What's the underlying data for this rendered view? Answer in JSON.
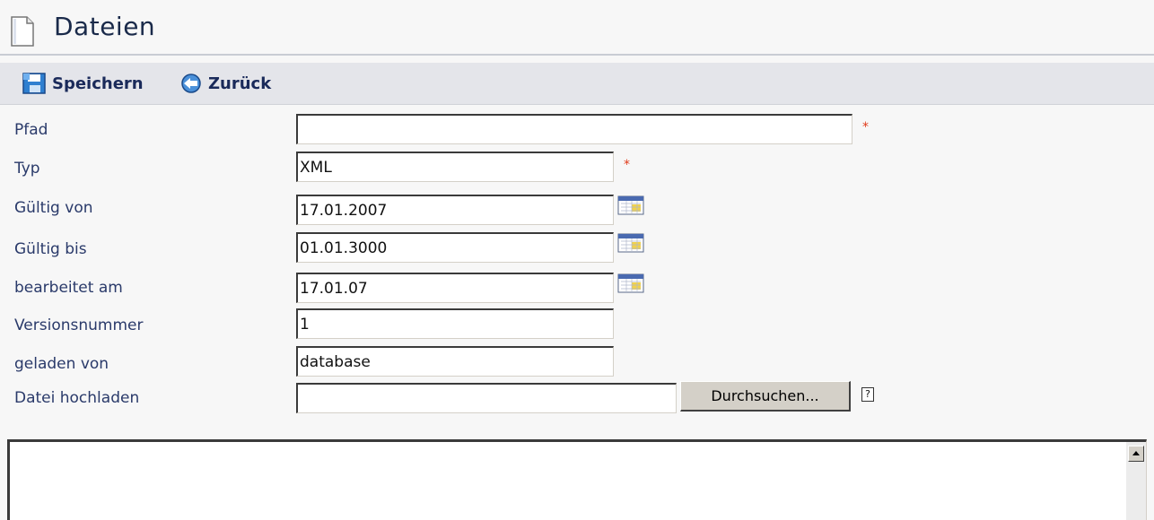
{
  "header": {
    "title": "Dateien",
    "icon": "document-icon"
  },
  "toolbar": {
    "save_label": "Speichern",
    "back_label": "Zurück",
    "save_icon": "save-icon",
    "back_icon": "back-arrow-icon"
  },
  "form": {
    "pfad": {
      "label": "Pfad",
      "value": ""
    },
    "typ": {
      "label": "Typ",
      "value": "XML"
    },
    "gueltig_von": {
      "label": "Gültig von",
      "value": "17.01.2007"
    },
    "gueltig_bis": {
      "label": "Gültig bis",
      "value": "01.01.3000"
    },
    "bearbeitet_am": {
      "label": "bearbeitet am",
      "value": "17.01.07"
    },
    "versionsnummer": {
      "label": "Versionsnummer",
      "value": "1"
    },
    "geladen_von": {
      "label": "geladen von",
      "value": "database"
    },
    "datei_hochladen": {
      "label": "Datei hochladen",
      "value": "",
      "browse_label": "Durchsuchen...",
      "help_label": "?"
    },
    "required_mark": "*"
  },
  "content": {
    "value": ""
  },
  "colors": {
    "required": "#e03a1a",
    "title": "#1a2a4a",
    "toolbar_bg": "#e4e5ea"
  }
}
